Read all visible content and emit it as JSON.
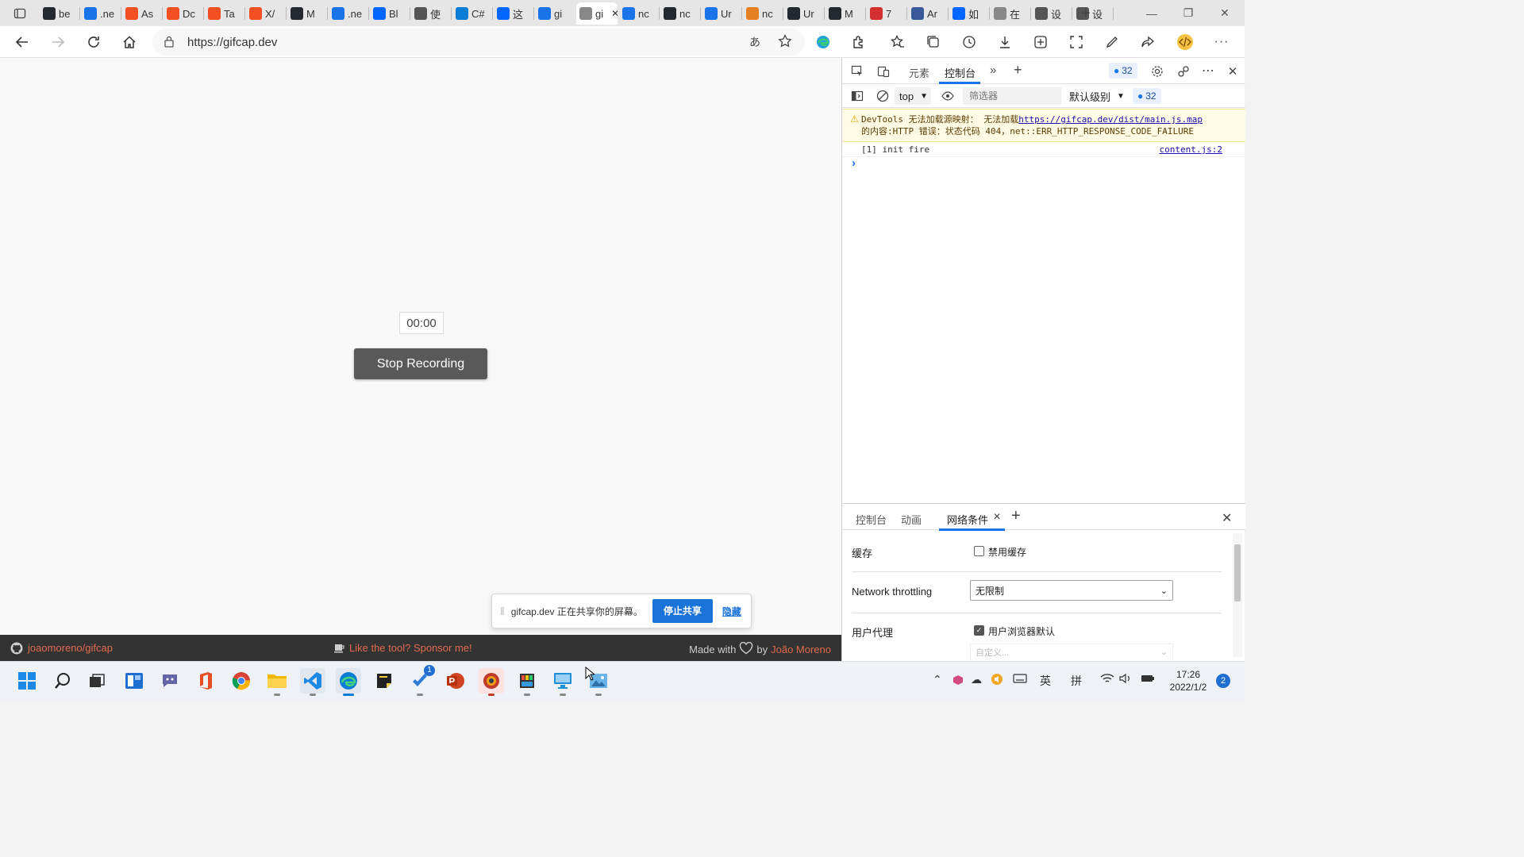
{
  "browser": {
    "tabs": [
      {
        "label": "be",
        "icon": "github-icon",
        "color": "#24292f"
      },
      {
        "label": ".ne",
        "icon": "bing-icon",
        "color": "#1a73e8"
      },
      {
        "label": "As",
        "icon": "microsoft-icon",
        "color": "#f25022"
      },
      {
        "label": "Dc",
        "icon": "microsoft-icon",
        "color": "#f25022"
      },
      {
        "label": "Ta",
        "icon": "microsoft-icon",
        "color": "#f25022"
      },
      {
        "label": "X/",
        "icon": "microsoft-icon",
        "color": "#f25022"
      },
      {
        "label": "M",
        "icon": "octocat-icon",
        "color": "#24292f"
      },
      {
        "label": ".ne",
        "icon": "bing-icon",
        "color": "#1a73e8"
      },
      {
        "label": "Bl",
        "icon": "zhihu-icon",
        "color": "#0066ff"
      },
      {
        "label": "使",
        "icon": "search-doc-icon",
        "color": "#555555"
      },
      {
        "label": "C#",
        "icon": "edge-icon",
        "color": "#0c7cd5"
      },
      {
        "label": "这",
        "icon": "zhihu-icon",
        "color": "#0066ff"
      },
      {
        "label": "gi",
        "icon": "bing-icon",
        "color": "#1a73e8"
      },
      {
        "label": "gi",
        "icon": "page-icon",
        "color": "#888888",
        "active": true
      },
      {
        "label": "nc",
        "icon": "bing-icon",
        "color": "#1a73e8"
      },
      {
        "label": "nc",
        "icon": "github-icon",
        "color": "#24292f"
      },
      {
        "label": "Ur",
        "icon": "bing-icon",
        "color": "#1a73e8"
      },
      {
        "label": "nc",
        "icon": "pen-icon",
        "color": "#e67e22"
      },
      {
        "label": "Ur",
        "icon": "github-icon",
        "color": "#24292f"
      },
      {
        "label": "M",
        "icon": "github-icon",
        "color": "#24292f"
      },
      {
        "label": "7",
        "icon": "vivaldi-icon",
        "color": "#d32f2f"
      },
      {
        "label": "Ar",
        "icon": "window-icon",
        "color": "#3b5998"
      },
      {
        "label": "如",
        "icon": "zhihu-icon",
        "color": "#0066ff"
      },
      {
        "label": "在",
        "icon": "page-icon",
        "color": "#888888"
      },
      {
        "label": "设",
        "icon": "gear-icon",
        "color": "#555555"
      },
      {
        "label": "设",
        "icon": "gear-icon",
        "color": "#555555"
      }
    ],
    "new_tab": "+",
    "url": "https://gifcap.dev"
  },
  "page": {
    "timer": "00:00",
    "stop_button": "Stop Recording",
    "footer": {
      "repo": "joaomoreno/gifcap",
      "sponsor": "Like the tool? Sponsor me!",
      "made_with": "Made with",
      "by": "by",
      "author": "João Moreno"
    }
  },
  "share_bar": {
    "message": "gifcap.dev 正在共享你的屏幕。",
    "stop_label": "停止共享",
    "hide_label": "隐藏"
  },
  "devtools": {
    "tabs": {
      "elements": "元素",
      "console": "控制台"
    },
    "issues_count": "32",
    "context": "top",
    "filter_placeholder": "筛选器",
    "levels": "默认级别",
    "messages": [
      {
        "type": "warning",
        "text": "DevTools 无法加载源映射： 无法加载",
        "link": "https://gifcap.dev/dist/main.js.map",
        "text2": "的内容:HTTP 错误：状态代码 404，net::ERR_HTTP_RESPONSE_CODE_FAILURE"
      },
      {
        "type": "log",
        "text": "[1] init fire",
        "source": "content.js:2"
      }
    ],
    "prompt": "›",
    "drawer": {
      "tabs": [
        "控制台",
        "动画",
        "网络条件"
      ],
      "cache_label": "缓存",
      "disable_cache": "禁用缓存",
      "throttling_label": "Network throttling",
      "throttling_value": "无限制",
      "ua_label": "用户代理",
      "ua_default": "用户浏览器默认",
      "ua_custom_placeholder": "自定义..."
    }
  },
  "taskbar": {
    "tray": {
      "lang": "英",
      "ime": "拼",
      "time": "17:26",
      "date": "2022/1/2",
      "notifications": "2"
    }
  }
}
